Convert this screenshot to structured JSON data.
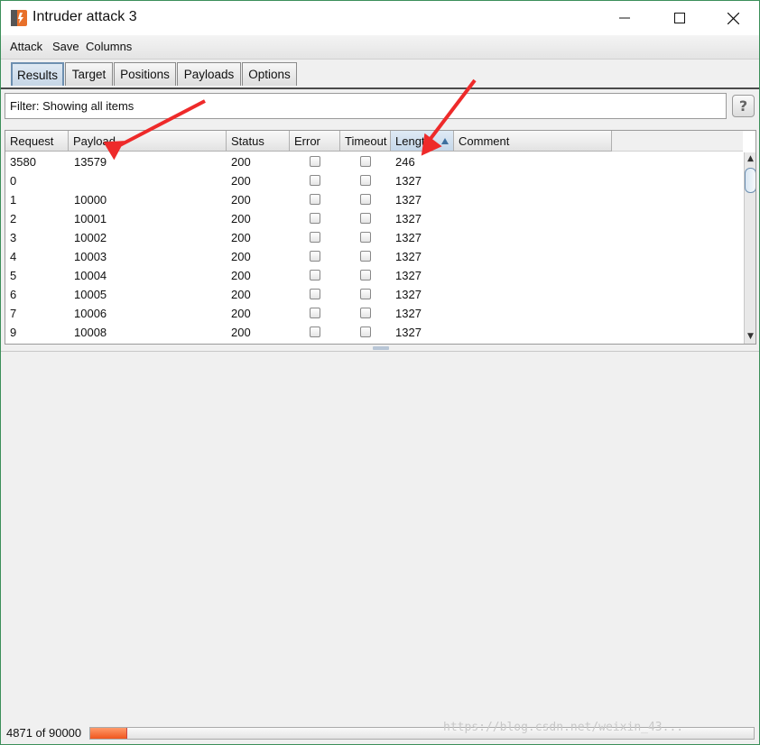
{
  "window": {
    "title": "Intruder attack 3"
  },
  "menu": [
    "Attack",
    "Save",
    "Columns"
  ],
  "tabs": [
    "Results",
    "Target",
    "Positions",
    "Payloads",
    "Options"
  ],
  "active_tab": "Results",
  "filter": {
    "text": "Filter: Showing all items"
  },
  "help_label": "?",
  "table": {
    "columns": [
      "Request",
      "Payload",
      "Status",
      "Error",
      "Timeout",
      "Length",
      "Comment"
    ],
    "sorted_column": "Length",
    "sort_direction": "ascending",
    "rows": [
      {
        "request": "3580",
        "payload": "13579",
        "status": "200",
        "error": false,
        "timeout": false,
        "length": "246",
        "comment": ""
      },
      {
        "request": "0",
        "payload": "",
        "status": "200",
        "error": false,
        "timeout": false,
        "length": "1327",
        "comment": ""
      },
      {
        "request": "1",
        "payload": "10000",
        "status": "200",
        "error": false,
        "timeout": false,
        "length": "1327",
        "comment": ""
      },
      {
        "request": "2",
        "payload": "10001",
        "status": "200",
        "error": false,
        "timeout": false,
        "length": "1327",
        "comment": ""
      },
      {
        "request": "3",
        "payload": "10002",
        "status": "200",
        "error": false,
        "timeout": false,
        "length": "1327",
        "comment": ""
      },
      {
        "request": "4",
        "payload": "10003",
        "status": "200",
        "error": false,
        "timeout": false,
        "length": "1327",
        "comment": ""
      },
      {
        "request": "5",
        "payload": "10004",
        "status": "200",
        "error": false,
        "timeout": false,
        "length": "1327",
        "comment": ""
      },
      {
        "request": "6",
        "payload": "10005",
        "status": "200",
        "error": false,
        "timeout": false,
        "length": "1327",
        "comment": ""
      },
      {
        "request": "7",
        "payload": "10006",
        "status": "200",
        "error": false,
        "timeout": false,
        "length": "1327",
        "comment": ""
      },
      {
        "request": "9",
        "payload": "10008",
        "status": "200",
        "error": false,
        "timeout": false,
        "length": "1327",
        "comment": ""
      }
    ]
  },
  "status": {
    "progress_text": "4871 of 90000",
    "progress_fraction": 0.054
  },
  "watermark": "https://blog.csdn.net/weixin_43...",
  "colors": {
    "accent": "#6d8fb0",
    "progress": "#f0561e",
    "annotation_arrow": "#ee2a2a"
  }
}
